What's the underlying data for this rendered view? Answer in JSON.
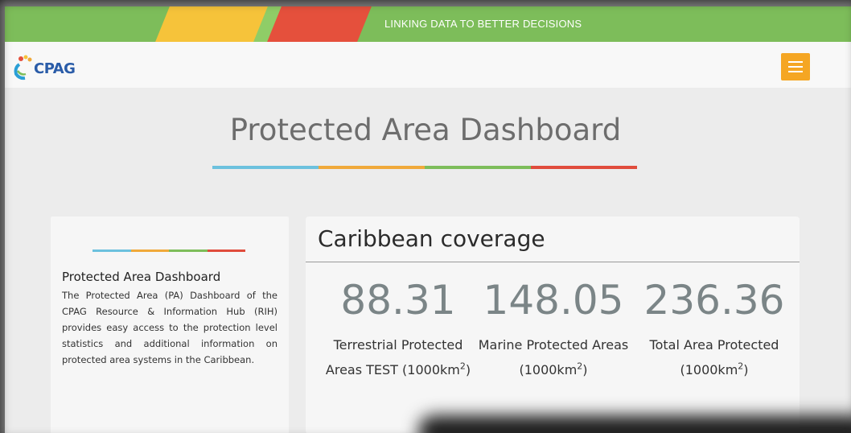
{
  "banner": {
    "tagline": "LINKING DATA TO BETTER DECISIONS",
    "colors": {
      "background": "#7dbd5a",
      "yellow": "#f6c33a",
      "red": "#e5503c"
    }
  },
  "navbar": {
    "logo_text": "CPAG",
    "menu_icon": "hamburger-menu-icon",
    "menu_color": "#f5a623"
  },
  "page": {
    "title": "Protected Area Dashboard",
    "accent_colors": [
      "#6cc1de",
      "#f0a93a",
      "#7dbd5a",
      "#e04c3c"
    ]
  },
  "info_card": {
    "title": "Protected Area Dashboard",
    "text": "The Protected Area (PA) Dashboard of the CPAG Resource & Information Hub (RIH) provides easy access to the protection level statistics and additional information on protected area systems in the Caribbean."
  },
  "coverage": {
    "title": "Caribbean coverage",
    "stats": [
      {
        "value": "88.31",
        "label": "Terrestrial Protected Areas TEST (1000km",
        "unit_sup": "2",
        "label_end": ")"
      },
      {
        "value": "148.05",
        "label": "Marine Protected Areas (1000km",
        "unit_sup": "2",
        "label_end": ")"
      },
      {
        "value": "236.36",
        "label": "Total Area Protected (1000km",
        "unit_sup": "2",
        "label_end": ")"
      }
    ]
  }
}
